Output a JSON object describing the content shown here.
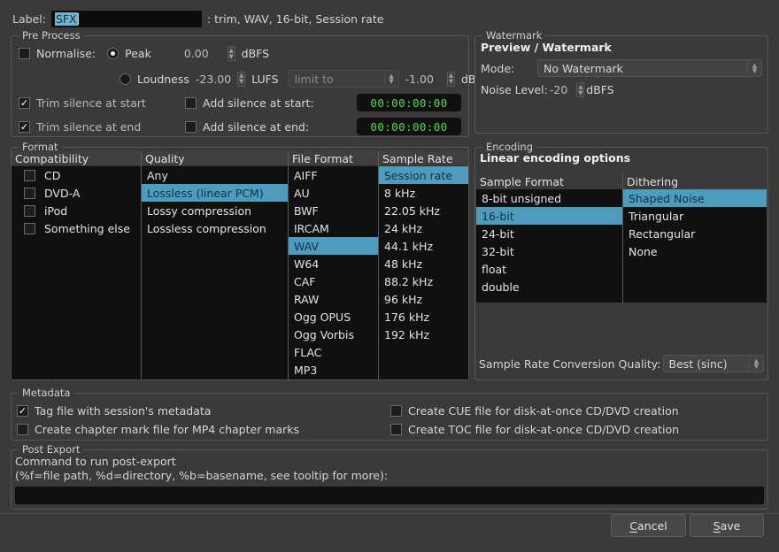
{
  "label_row": {
    "caption": "Label:",
    "value": "SFX",
    "suffix": ": trim, WAV, 16-bit, Session rate"
  },
  "pre_process": {
    "title": "Pre Process",
    "normalise_label": "Normalise:",
    "normalise_checked": false,
    "peak_label": "Peak",
    "peak_selected": true,
    "peak_value": "0.00",
    "peak_unit": "dBFS",
    "loudness_label": "Loudness",
    "loudness_selected": false,
    "loudness_value": "-23.00",
    "loudness_unit": "LUFS",
    "limit_to_label": "limit to",
    "limit_value": "-1.00",
    "limit_unit": "dBTP",
    "trim_start_label": "Trim silence at start",
    "trim_start_checked": true,
    "trim_end_label": "Trim silence at end",
    "trim_end_checked": true,
    "add_start_label": "Add silence at start:",
    "add_start_checked": false,
    "add_start_time": "00:00:00:00",
    "add_end_label": "Add silence at end:",
    "add_end_checked": false,
    "add_end_time": "00:00:00:00"
  },
  "watermark": {
    "title": "Watermark",
    "heading": "Preview / Watermark",
    "mode_label": "Mode:",
    "mode_value": "No Watermark",
    "noise_label": "Noise Level:",
    "noise_value": "-20",
    "noise_unit": "dBFS"
  },
  "format": {
    "title": "Format",
    "columns": [
      {
        "header": "Compatibility",
        "type": "checkbox",
        "items": [
          {
            "label": "CD",
            "checked": false
          },
          {
            "label": "DVD-A",
            "checked": false
          },
          {
            "label": "iPod",
            "checked": false
          },
          {
            "label": "Something else",
            "checked": false
          }
        ]
      },
      {
        "header": "Quality",
        "type": "list",
        "items": [
          {
            "label": "Any",
            "selected": false
          },
          {
            "label": "Lossless (linear PCM)",
            "selected": true
          },
          {
            "label": "Lossy compression",
            "selected": false
          },
          {
            "label": "Lossless compression",
            "selected": false
          }
        ]
      },
      {
        "header": "File Format",
        "type": "list",
        "items": [
          {
            "label": "AIFF",
            "selected": false
          },
          {
            "label": "AU",
            "selected": false
          },
          {
            "label": "BWF",
            "selected": false
          },
          {
            "label": "IRCAM",
            "selected": false
          },
          {
            "label": "WAV",
            "selected": true
          },
          {
            "label": "W64",
            "selected": false
          },
          {
            "label": "CAF",
            "selected": false
          },
          {
            "label": "RAW",
            "selected": false
          },
          {
            "label": "Ogg OPUS",
            "selected": false
          },
          {
            "label": "Ogg Vorbis",
            "selected": false
          },
          {
            "label": "FLAC",
            "selected": false
          },
          {
            "label": "MP3",
            "selected": false
          }
        ]
      },
      {
        "header": "Sample Rate",
        "type": "list",
        "items": [
          {
            "label": "Session rate",
            "selected": true
          },
          {
            "label": "8 kHz",
            "selected": false
          },
          {
            "label": "22.05 kHz",
            "selected": false
          },
          {
            "label": "24 kHz",
            "selected": false
          },
          {
            "label": "44.1 kHz",
            "selected": false
          },
          {
            "label": "48 kHz",
            "selected": false
          },
          {
            "label": "88.2 kHz",
            "selected": false
          },
          {
            "label": "96 kHz",
            "selected": false
          },
          {
            "label": "176 kHz",
            "selected": false
          },
          {
            "label": "192 kHz",
            "selected": false
          }
        ]
      }
    ]
  },
  "encoding": {
    "title": "Encoding",
    "heading": "Linear encoding options",
    "sample_format_header": "Sample Format",
    "sample_formats": [
      {
        "label": "8-bit unsigned",
        "selected": false
      },
      {
        "label": "16-bit",
        "selected": true
      },
      {
        "label": "24-bit",
        "selected": false
      },
      {
        "label": "32-bit",
        "selected": false
      },
      {
        "label": "float",
        "selected": false
      },
      {
        "label": "double",
        "selected": false
      }
    ],
    "dithering_header": "Dithering",
    "dithering": [
      {
        "label": "Shaped Noise",
        "selected": true
      },
      {
        "label": "Triangular",
        "selected": false
      },
      {
        "label": "Rectangular",
        "selected": false
      },
      {
        "label": "None",
        "selected": false
      }
    ],
    "srq_label": "Sample Rate Conversion Quality:",
    "srq_value": "Best (sinc)"
  },
  "metadata": {
    "title": "Metadata",
    "items": [
      {
        "label": "Tag file with session's metadata",
        "checked": true
      },
      {
        "label": "Create chapter mark file for MP4 chapter marks",
        "checked": false
      },
      {
        "label": "Create CUE file for disk-at-once CD/DVD creation",
        "checked": false
      },
      {
        "label": "Create TOC file for disk-at-once CD/DVD creation",
        "checked": false
      }
    ]
  },
  "post_export": {
    "title": "Post Export",
    "line1": "Command to run post-export",
    "line2": "(%f=file path, %d=directory, %b=basename, see tooltip for more):",
    "command_value": ""
  },
  "buttons": {
    "cancel_mnemonic": "C",
    "cancel_rest": "ancel",
    "save_mnemonic": "S",
    "save_rest": "ave"
  },
  "colors": {
    "selection": "#4d9bbd",
    "timecode_green": "#4fdc4f",
    "background": "#3a3a3a",
    "list_background": "#101010"
  }
}
